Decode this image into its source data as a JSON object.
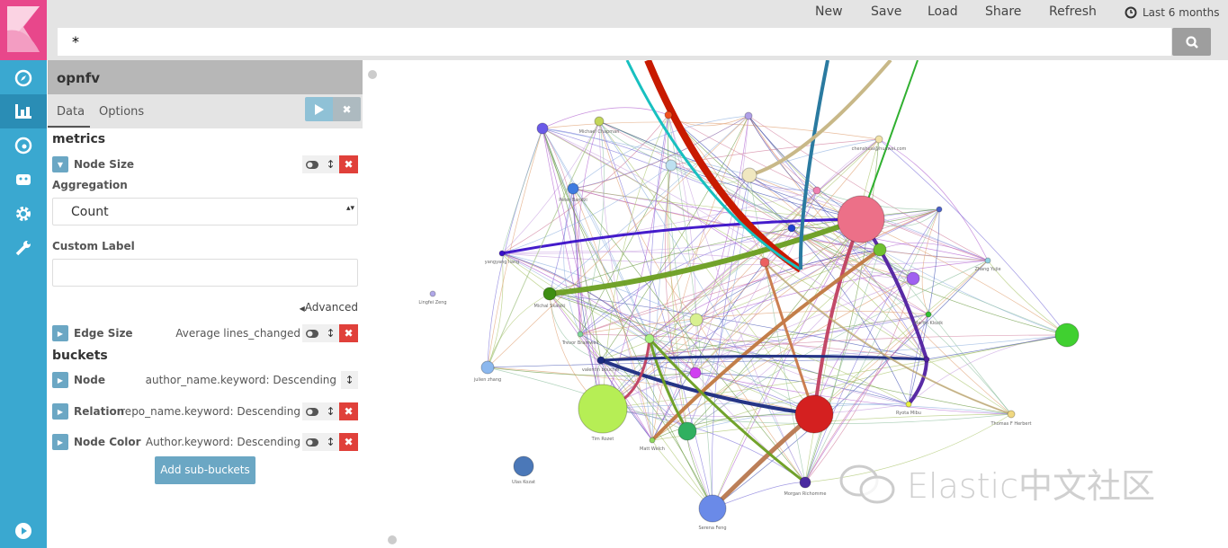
{
  "topbar": {
    "menu": [
      "New",
      "Save",
      "Load",
      "Share",
      "Refresh"
    ],
    "time_range": "Last 6 months"
  },
  "search": {
    "value": "*"
  },
  "sidebar": {
    "items": [
      "discover",
      "visualize",
      "dashboard",
      "timelion",
      "management",
      "dev-tools"
    ],
    "active": "visualize"
  },
  "panel": {
    "title": "opnfv",
    "tabs": [
      "Data",
      "Options"
    ],
    "metrics_heading": "metrics",
    "node_size": {
      "label": "Node Size"
    },
    "aggregation_label": "Aggregation",
    "aggregation_value": "Count",
    "custom_label": "Custom Label",
    "custom_label_value": "",
    "advanced": "Advanced",
    "edge_size": {
      "label": "Edge Size",
      "value": "Average lines_changed"
    },
    "buckets_heading": "buckets",
    "node": {
      "label": "Node",
      "value": "author_name.keyword: Descending"
    },
    "relation": {
      "label": "Relation",
      "value": "repo_name.keyword: Descending"
    },
    "node_color": {
      "label": "Node Color",
      "value": "Author.keyword: Descending"
    },
    "add_sub_buckets": "Add sub-buckets"
  },
  "graph": {
    "nodes": [
      {
        "label": "",
        "color": "#6a5ae8"
      },
      {
        "label": "Michael Chapman",
        "color": "#c3d65a"
      },
      {
        "label": "Peter Bandzi",
        "color": "#3f7be0"
      },
      {
        "label": "yangyang liang",
        "color": "#3a10c8"
      },
      {
        "label": "Lingfei Zeng",
        "color": "#b0a8e8"
      },
      {
        "label": "Michal Skalski",
        "color": "#3e8e12"
      },
      {
        "label": "Trevor Bramwell",
        "color": "#7ed69a"
      },
      {
        "label": "julien zhang",
        "color": "#8cb8ee"
      },
      {
        "label": "valentin boucher",
        "color": "#1a2a80"
      },
      {
        "label": "Tim Rozet",
        "color": "#b6ee55"
      },
      {
        "label": "Matt Welch",
        "color": "#90d860"
      },
      {
        "label": "Ulas Kozat",
        "color": "#4b78b8"
      },
      {
        "label": "Serena Feng",
        "color": "#6a8ae8"
      },
      {
        "label": "Morgan Richomme",
        "color": "#4a2aa0"
      },
      {
        "label": "",
        "color": "#d42020"
      },
      {
        "label": "",
        "color": "#ec7088"
      },
      {
        "label": "chenshuai@huawei.com",
        "color": "#f2e2a8"
      },
      {
        "label": "",
        "color": "#4a60c8"
      },
      {
        "label": "Zhang Yujie",
        "color": "#90d0e0"
      },
      {
        "label": "Martin Klozik",
        "color": "#30c030"
      },
      {
        "label": "",
        "color": "#40d030"
      },
      {
        "label": "Thomas F Herbert",
        "color": "#f0d880"
      },
      {
        "label": "Ryota Mibu",
        "color": "#e8f040"
      },
      {
        "label": "",
        "color": "#a060f0"
      },
      {
        "label": "",
        "color": "#70c030"
      },
      {
        "label": "",
        "color": "#5020a0"
      },
      {
        "label": "",
        "color": "#f0e8c0"
      },
      {
        "label": "",
        "color": "#f05020"
      },
      {
        "label": "",
        "color": "#b0a0e8"
      },
      {
        "label": "",
        "color": "#bde0f0"
      },
      {
        "label": "",
        "color": "#2040d0"
      },
      {
        "label": "",
        "color": "#ec6060"
      },
      {
        "label": "",
        "color": "#d8f090"
      },
      {
        "label": "",
        "color": "#30b060"
      },
      {
        "label": "",
        "color": "#d040f0"
      },
      {
        "label": "",
        "color": "#a8f080"
      },
      {
        "label": "",
        "color": "#f080b0"
      }
    ]
  },
  "watermark": "Elastic中文社区"
}
